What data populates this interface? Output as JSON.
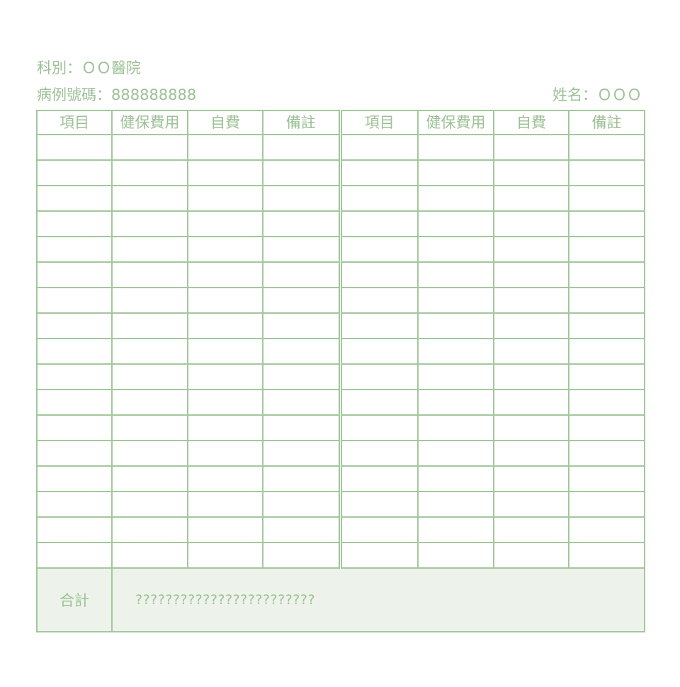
{
  "header": {
    "department": "科別：ＯＯ醫院",
    "chart_number": "病例號碼：888888888",
    "patient_name": "姓名：ＯＯＯ"
  },
  "table": {
    "columns": [
      "項目",
      "健保費用",
      "自費",
      "備註",
      "項目",
      "健保費用",
      "自費",
      "備註"
    ],
    "empty_row_count": 17,
    "total_label": "合計",
    "total_value": "????????????????????????"
  },
  "colors": {
    "grid": "#a3c79c",
    "text": "#9cc095",
    "total_background": "#edf3ea"
  }
}
